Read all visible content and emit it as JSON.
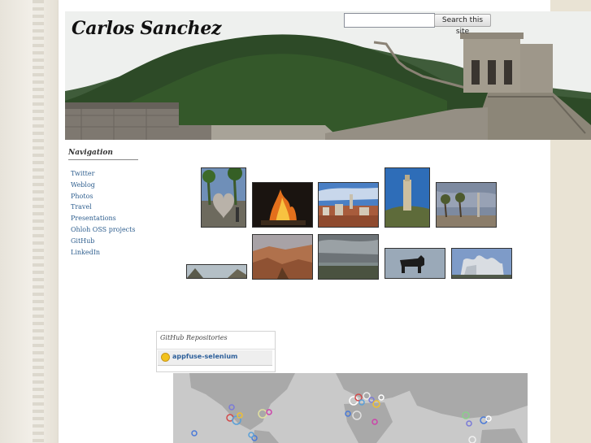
{
  "header": {
    "site_title": "Carlos Sanchez",
    "search_placeholder": "",
    "search_button": "Search this site",
    "banner_image": "great-wall-photo"
  },
  "navigation": {
    "title": "Navigation",
    "items": [
      {
        "label": "Twitter"
      },
      {
        "label": "Weblog"
      },
      {
        "label": "Photos"
      },
      {
        "label": "Travel"
      },
      {
        "label": "Presentations"
      },
      {
        "label": "Ohloh OSS projects"
      },
      {
        "label": "GitHub"
      },
      {
        "label": "LinkedIn"
      }
    ]
  },
  "photos": [
    {
      "name": "heart-sculpture-photo"
    },
    {
      "name": "bonfire-photo"
    },
    {
      "name": "city-rooftops-photo"
    },
    {
      "name": "lighthouse-tower-photo"
    },
    {
      "name": "monument-palms-photo"
    },
    {
      "name": "mountain-valley-photo"
    },
    {
      "name": "canyon-photo"
    },
    {
      "name": "cloudy-landscape-photo"
    },
    {
      "name": "bull-silhouette-photo"
    },
    {
      "name": "modern-building-photo"
    }
  ],
  "github": {
    "title": "GitHub Repositories",
    "repo_label": "appfuse-selenium"
  },
  "map": {
    "name": "visitor-map"
  },
  "colors": {
    "link": "#2f5f8f",
    "background": "#ece7dc",
    "page": "#ffffff"
  }
}
